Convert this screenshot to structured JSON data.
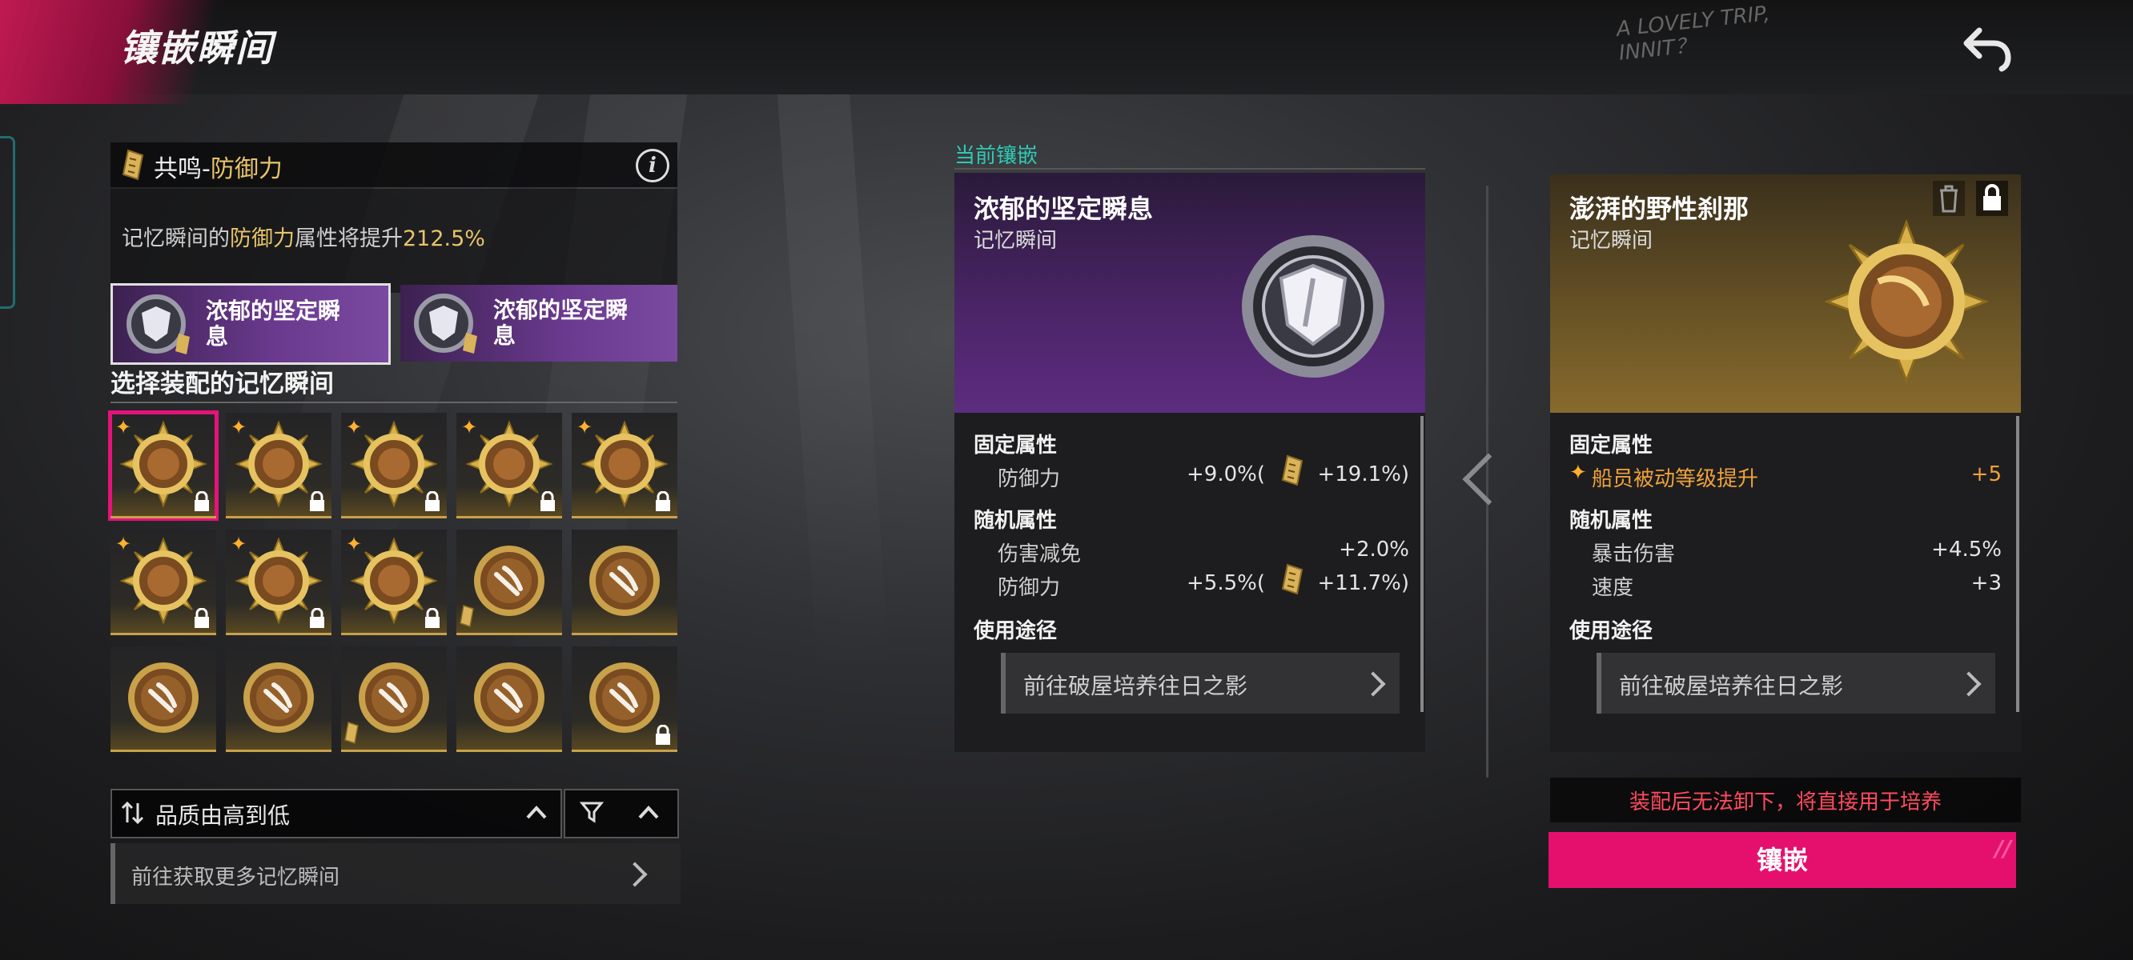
{
  "header": {
    "title": "镶嵌瞬间",
    "tagline_line1": "A LOVELY TRIP,",
    "tagline_line2": "INNIT？"
  },
  "resonance": {
    "prefix": "共鸣-",
    "stat": "防御力",
    "desc_prefix": "记忆瞬间的",
    "desc_stat": "防御力",
    "desc_mid": "属性将提升",
    "desc_value": "212.5%"
  },
  "slots": [
    {
      "name": "浓郁的坚定瞬息"
    },
    {
      "name": "浓郁的坚定瞬息"
    }
  ],
  "selection": {
    "title": "选择装配的记忆瞬间",
    "items": [
      {
        "star": true,
        "locked": true,
        "tag": false,
        "selected": true
      },
      {
        "star": true,
        "locked": true,
        "tag": false
      },
      {
        "star": true,
        "locked": true,
        "tag": false
      },
      {
        "star": true,
        "locked": true,
        "tag": false
      },
      {
        "star": true,
        "locked": true,
        "tag": false
      },
      {
        "star": true,
        "locked": true,
        "tag": false
      },
      {
        "star": true,
        "locked": true,
        "tag": false
      },
      {
        "star": true,
        "locked": true,
        "tag": false
      },
      {
        "star": false,
        "locked": false,
        "tag": true
      },
      {
        "star": false,
        "locked": false,
        "tag": false
      },
      {
        "star": false,
        "locked": false,
        "tag": false
      },
      {
        "star": false,
        "locked": false,
        "tag": false
      },
      {
        "star": false,
        "locked": false,
        "tag": true
      },
      {
        "star": false,
        "locked": false,
        "tag": false
      },
      {
        "star": false,
        "locked": true,
        "tag": false
      }
    ]
  },
  "sort": {
    "label": "品质由高到低"
  },
  "more_link": {
    "label": "前往获取更多记忆瞬间"
  },
  "current": {
    "label": "当前镶嵌",
    "name": "浓郁的坚定瞬息",
    "type": "记忆瞬间",
    "fixed_title": "固定属性",
    "fixed": [
      {
        "name": "防御力",
        "value": "+9.0%(",
        "bonus": "+19.1%)"
      }
    ],
    "random_title": "随机属性",
    "random": [
      {
        "name": "伤害减免",
        "value": "+2.0%"
      },
      {
        "name": "防御力",
        "value": "+5.5%(",
        "bonus": "+11.7%)"
      }
    ],
    "usage_title": "使用途径",
    "usage_link": "前往破屋培养往日之影"
  },
  "candidate": {
    "name": "澎湃的野性刹那",
    "type": "记忆瞬间",
    "fixed_title": "固定属性",
    "fixed": [
      {
        "name": "船员被动等级提升",
        "value": "+5"
      }
    ],
    "random_title": "随机属性",
    "random": [
      {
        "name": "暴击伤害",
        "value": "+4.5%"
      },
      {
        "name": "速度",
        "value": "+3"
      }
    ],
    "usage_title": "使用途径",
    "usage_link": "前往破屋培养往日之影"
  },
  "warning": "装配后无法卸下，将直接用于培养",
  "embed_button": "镶嵌",
  "colors": {
    "accent": "#e5106e",
    "gold": "#e7c46a",
    "teal": "#2ec9b6",
    "warning": "#ff4a5e",
    "purple": "#5d2c80"
  }
}
